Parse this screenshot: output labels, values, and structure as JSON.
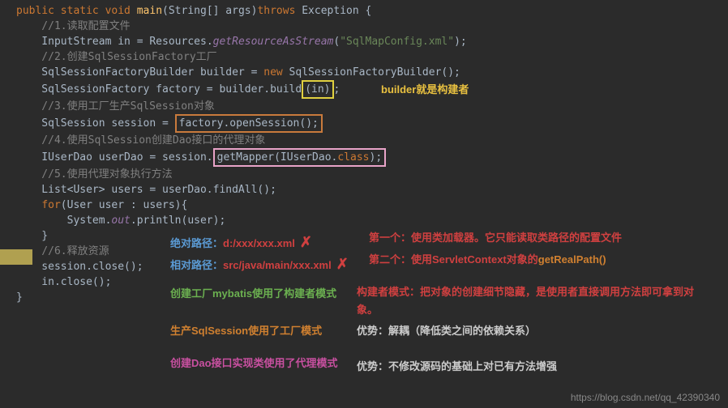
{
  "code": {
    "l1_pre": "public static void",
    "l1_method": " main",
    "l1_params": "(String[] args)",
    "l1_throws": "throws",
    "l1_rest": " Exception {",
    "l2": "    //1.读取配置文件",
    "l3_pre": "    InputStream in = Resources",
    "l3_dot": ".",
    "l3_method": "getResourceAsStream",
    "l3_arg": "(\"SqlMapConfig.xml\");",
    "l3_str": "\"SqlMapConfig.xml\"",
    "l4": "    //2.创建SqlSessionFactory工厂",
    "l5_pre": "    SqlSessionFactoryBuilder builder = ",
    "l5_new": "new",
    "l5_post": " SqlSessionFactoryBuilder();",
    "l6_pre": "    SqlSessionFactory factory = builder.build",
    "l6_param": "(in)",
    "l6_semi": ";",
    "l7": "    //3.使用工厂生产SqlSession对象",
    "l8_pre": "    SqlSession session = ",
    "l8_box": "factory.openSession();",
    "l9": "    //4.使用SqlSession创建Dao接口的代理对象",
    "l10_pre": "    IUserDao userDao = session.",
    "l10_box": "getMapper(IUserDao.class);",
    "l10_kw": "class",
    "l11": "    //5.使用代理对象执行方法",
    "l12": "    List<User> users = userDao.findAll();",
    "l13_for": "for",
    "l13_rest": "(User user : users){",
    "l14_pre": "        System.",
    "l14_out": "out",
    "l14_rest": ".println(user);",
    "l15": "    }",
    "l16": "    //6.释放资源",
    "l17": "    session.close();",
    "l18": "    in.close();",
    "l19": "}"
  },
  "annotations": {
    "builder_note": "builder就是构建者",
    "abs_path_label": "绝对路径：",
    "abs_path_val": "d:/xxx/xxx",
    "rel_path_label": "相对路径：",
    "rel_path_val": "src/java/main/xxx",
    "xml": ".xml",
    "first_note": "第一个：使用类加载器。它只能读取类路径的配置文件",
    "second_note_a": "第二个：使用ServletContext对象的",
    "second_note_b": "getRealPath()",
    "factory_builder": "创建工厂mybatis使用了构建者模式",
    "builder_pattern": "构建者模式：把对象的创建细节隐藏，是使用者直接调用方法即可拿到对象。",
    "session_factory": "生产SqlSession使用了工厂模式",
    "factory_adv": "优势：解耦（降低类之间的依赖关系）",
    "dao_proxy": "创建Dao接口实现类使用了代理模式",
    "proxy_adv": "优势：不修改源码的基础上对已有方法增强"
  },
  "watermark": "https://blog.csdn.net/qq_42390340"
}
